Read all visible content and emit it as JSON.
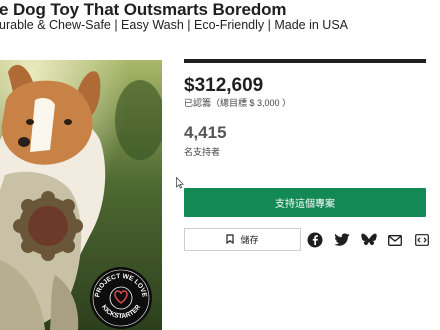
{
  "project": {
    "title": "e Dog Toy That Outsmarts Boredom",
    "subtitle": "urable & Chew-Safe | Easy Wash | Eco-Friendly | Made in USA"
  },
  "badge": {
    "lines": [
      "PROJECT WE LOVE",
      "KICKSTARTER"
    ]
  },
  "stats": {
    "pledged": "$312,609",
    "goal": "已認籌（總目標 $ 3,000 ）",
    "backers_count": "4,415",
    "backers_label": "名支持者"
  },
  "actions": {
    "back_label": "支持這個專案",
    "save_label": "儲存"
  },
  "share_icons": [
    "facebook-icon",
    "twitter-icon",
    "butterfly-icon",
    "email-icon",
    "embed-icon"
  ],
  "colors": {
    "primary_green": "#138a55",
    "text_dark": "#1f1f1f"
  }
}
